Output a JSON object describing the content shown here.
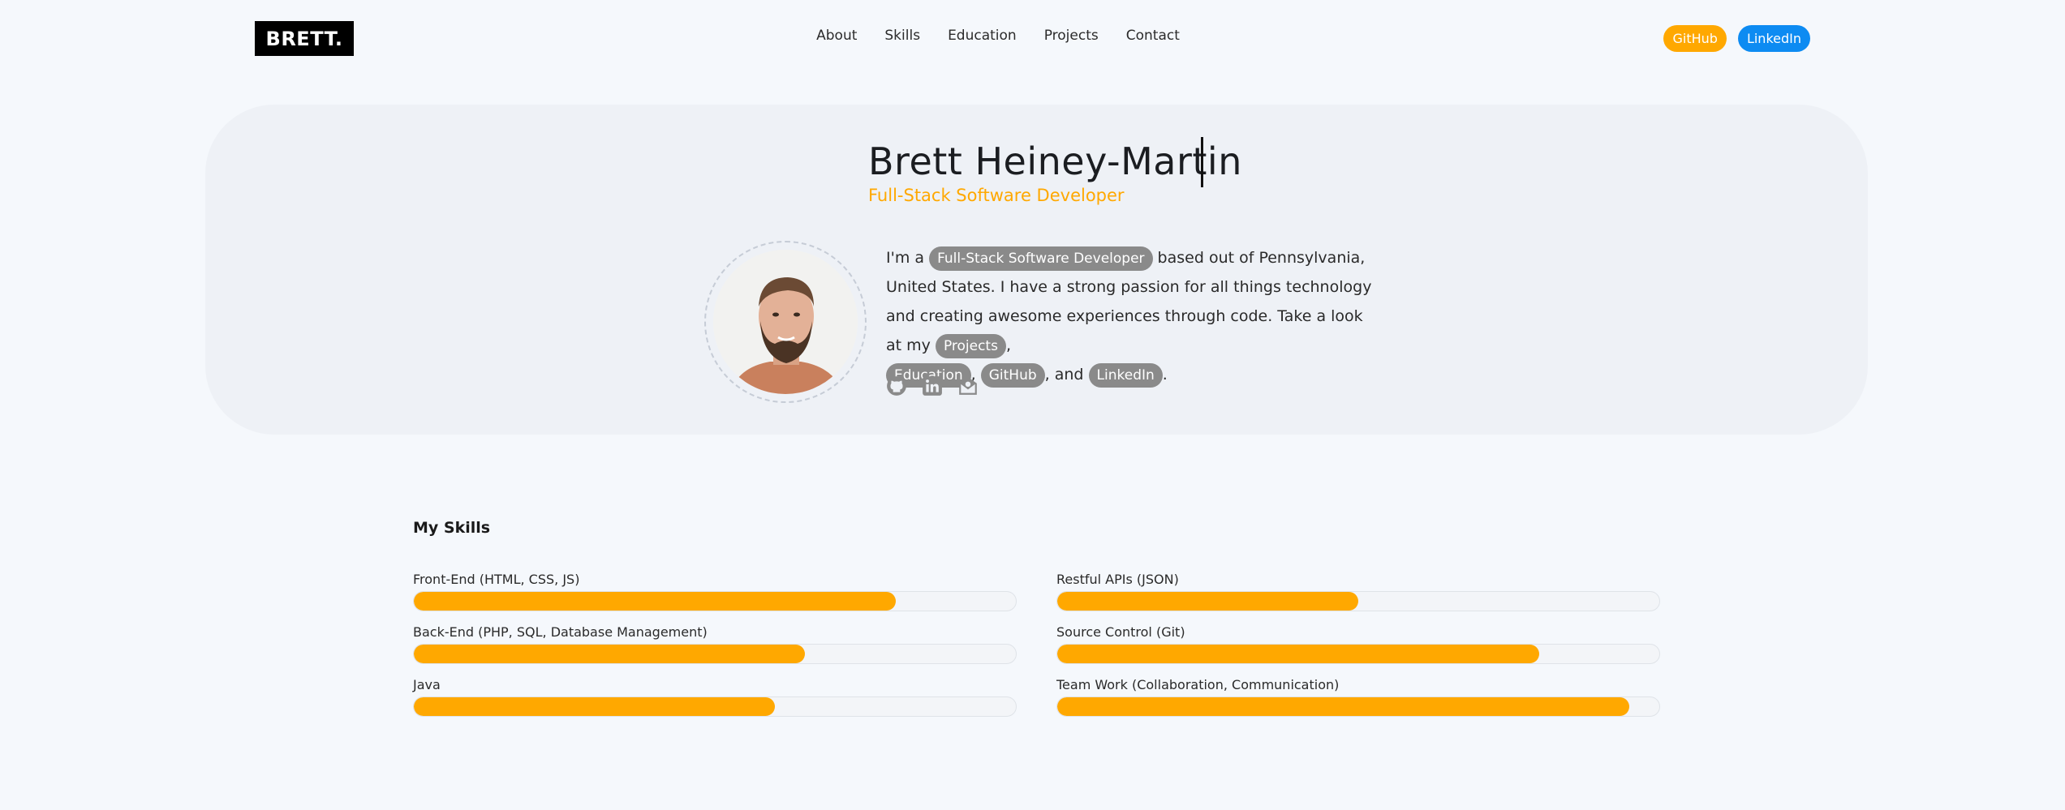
{
  "brand": {
    "logo": "BRETT."
  },
  "nav": {
    "items": [
      "About",
      "Skills",
      "Education",
      "Projects",
      "Contact"
    ]
  },
  "social": {
    "github": {
      "label": "GitHub",
      "color": "#ffa800"
    },
    "linkedin": {
      "label": "LinkedIn",
      "color": "#0d8bf2"
    }
  },
  "hero": {
    "name": "Brett Heiney-Martin",
    "subtitle": "Full-Stack Software Developer",
    "accent": "#ffa800",
    "bio": {
      "t1": "I'm a ",
      "tag_role": "Full-Stack Software Developer",
      "t2": " based out of Pennsylvania, United States. I have a strong passion for all things technology and creating awesome experiences through code. Take a look at my ",
      "tag_projects": "Projects",
      "t3": ",",
      "tag_education": "Education",
      "t4": ",",
      "tag_github": "GitHub",
      "t5": ", and",
      "tag_linkedin": "LinkedIn",
      "t6": "."
    },
    "icons": [
      "github-icon",
      "linkedin-icon",
      "mail-icon"
    ]
  },
  "skills": {
    "title": "My Skills",
    "bar_color": "#ffa800",
    "items": [
      {
        "label": "Front-End (HTML, CSS, JS)",
        "level": 0.8
      },
      {
        "label": "Restful APIs (JSON)",
        "level": 0.5
      },
      {
        "label": "Back-End (PHP, SQL, Database Management)",
        "level": 0.65
      },
      {
        "label": "Source Control (Git)",
        "level": 0.8
      },
      {
        "label": "Java",
        "level": 0.6
      },
      {
        "label": "Team Work (Collaboration, Communication)",
        "level": 0.95
      }
    ]
  }
}
